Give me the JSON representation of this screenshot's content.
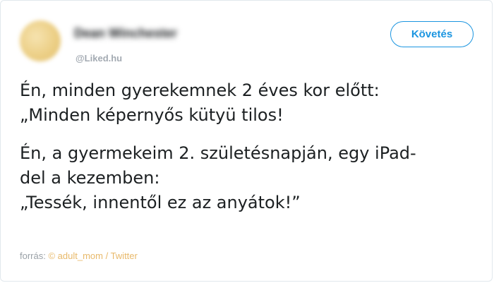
{
  "tweet": {
    "display_name": "Dean Winchester",
    "handle": "@Liked.hu",
    "follow_label": "Követés",
    "paragraphs": [
      "Én, minden gyerekemnek 2 éves kor előtt:\n„Minden képernyős kütyü tilos!",
      "Én, a gyermekeim 2. születésnapján, egy iPad-\ndel a kezemben:\n„Tessék, innentől ez az anyátok!”"
    ]
  },
  "source": {
    "label": "forrás:",
    "credit": "© adult_mom / Twitter"
  },
  "colors": {
    "accent": "#1b95e0",
    "credit": "#e8b96a",
    "muted": "#9aa1a7"
  }
}
